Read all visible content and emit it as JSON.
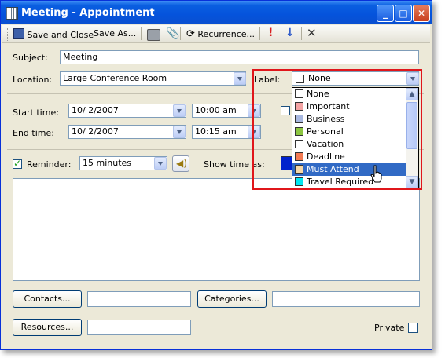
{
  "window": {
    "title": "Meeting - Appointment"
  },
  "toolbar": {
    "save_close": "Save and Close",
    "save_as": "Save As...",
    "recurrence": "Recurrence..."
  },
  "form": {
    "subject_label": "Subject:",
    "subject_value": "Meeting",
    "location_label": "Location:",
    "location_value": "Large Conference Room",
    "label_label": "Label:",
    "label_value": "None",
    "start_label": "Start time:",
    "start_date": "10/  2/2007",
    "start_time": "10:00 am",
    "end_label": "End time:",
    "end_date": "10/  2/2007",
    "end_time": "10:15 am",
    "reminder_label": "Reminder:",
    "reminder_value": "15 minutes",
    "show_time_label": "Show time as:",
    "contacts_button": "Contacts...",
    "categories_button": "Categories...",
    "resources_button": "Resources...",
    "private_label": "Private"
  },
  "label_options": [
    {
      "name": "None",
      "color": "#ffffff"
    },
    {
      "name": "Important",
      "color": "#f4a3a3"
    },
    {
      "name": "Business",
      "color": "#a8b8e0"
    },
    {
      "name": "Personal",
      "color": "#8cc640"
    },
    {
      "name": "Vacation",
      "color": "#ffffff"
    },
    {
      "name": "Deadline",
      "color": "#f47a52"
    },
    {
      "name": "Must Attend",
      "color": "#f6d8a8",
      "selected": true
    },
    {
      "name": "Travel Required",
      "color": "#00e6f0"
    }
  ],
  "colors": {
    "highlight": "#316ac5",
    "annotation_box": "#e0161b",
    "title_bar": "#0553dc"
  }
}
